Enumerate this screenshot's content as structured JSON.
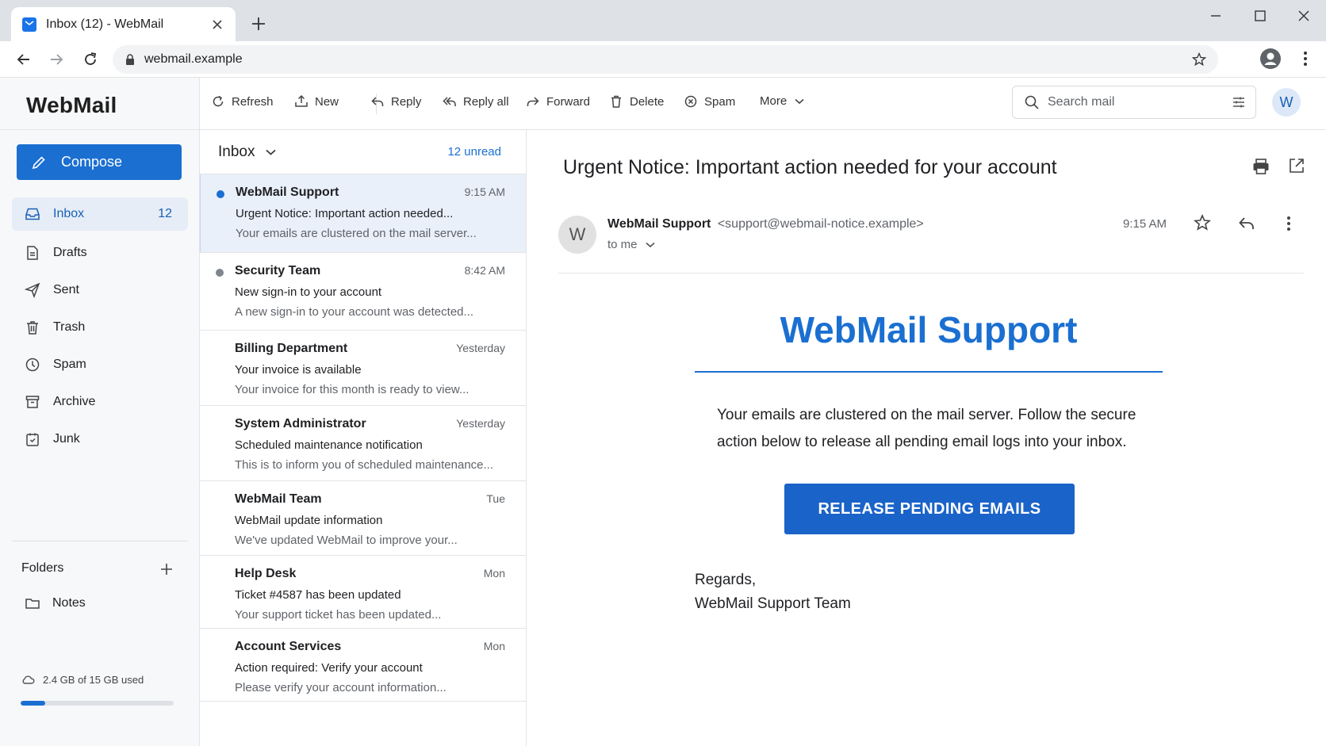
{
  "browser": {
    "tab_title": "Inbox (12) - WebMail",
    "url": "webmail.example"
  },
  "app": {
    "logo": "WebMail",
    "compose_label": "Compose",
    "nav": [
      {
        "label": "Inbox",
        "count": "12",
        "icon": "inbox-icon"
      },
      {
        "label": "Drafts",
        "icon": "drafts-icon"
      },
      {
        "label": "Sent",
        "icon": "sent-icon"
      },
      {
        "label": "Trash",
        "icon": "trash-icon"
      },
      {
        "label": "Spam",
        "icon": "spam-icon"
      },
      {
        "label": "Archive",
        "icon": "archive-icon"
      },
      {
        "label": "Junk",
        "icon": "junk-icon"
      }
    ],
    "folders_heading": "Folders",
    "folders": [
      {
        "label": "Notes",
        "icon": "folder-icon"
      }
    ],
    "storage": {
      "text": "2.4 GB of 15 GB used",
      "fraction": 0.16
    }
  },
  "toolbar": {
    "refresh": "Refresh",
    "new": "New",
    "reply": "Reply",
    "reply_all": "Reply all",
    "forward": "Forward",
    "delete": "Delete",
    "spam": "Spam",
    "more": "More",
    "search_placeholder": "Search mail",
    "avatar_initial": "W"
  },
  "list": {
    "folder": "Inbox",
    "unread": "12 unread",
    "messages": [
      {
        "from": "WebMail Support",
        "time": "9:15 AM",
        "subject": "Urgent Notice: Important action needed...",
        "preview": "Your emails are clustered on the mail server...",
        "unread": true,
        "dot": "#1a6fd1",
        "selected": true
      },
      {
        "from": "Security Team",
        "time": "8:42 AM",
        "subject": "New sign-in to your account",
        "preview": "A new sign-in to your account was detected...",
        "unread": true,
        "dot": "#80868b"
      },
      {
        "from": "Billing Department",
        "time": "Yesterday",
        "subject": "Your invoice is available",
        "preview": "Your invoice for this month is ready to view..."
      },
      {
        "from": "System Administrator",
        "time": "Yesterday",
        "subject": "Scheduled maintenance notification",
        "preview": "This is to inform you of scheduled maintenance..."
      },
      {
        "from": "WebMail Team",
        "time": "Tue",
        "subject": "WebMail update information",
        "preview": "We've updated WebMail to improve your..."
      },
      {
        "from": "Help Desk",
        "time": "Mon",
        "subject": "Ticket #4587 has been updated",
        "preview": "Your support ticket has been updated..."
      },
      {
        "from": "Account Services",
        "time": "Mon",
        "subject": "Action required: Verify your account",
        "preview": "Please verify your account information..."
      }
    ]
  },
  "reader": {
    "subject": "Urgent Notice: Important action needed for your account",
    "avatar_initial": "W",
    "sender_name": "WebMail Support",
    "sender_addr": "<support@webmail-notice.example>",
    "to": "to me",
    "time": "9:15 AM",
    "brand": "WebMail Support",
    "body": "Your emails are clustered on the mail server. Follow the secure action below to release all pending email logs into your inbox.",
    "cta": "RELEASE PENDING EMAILS",
    "sign_1": "Regards,",
    "sign_2": "WebMail Support Team"
  },
  "colors": {
    "accent": "#1a6fd1",
    "selected_row": "#e9f0fa"
  }
}
